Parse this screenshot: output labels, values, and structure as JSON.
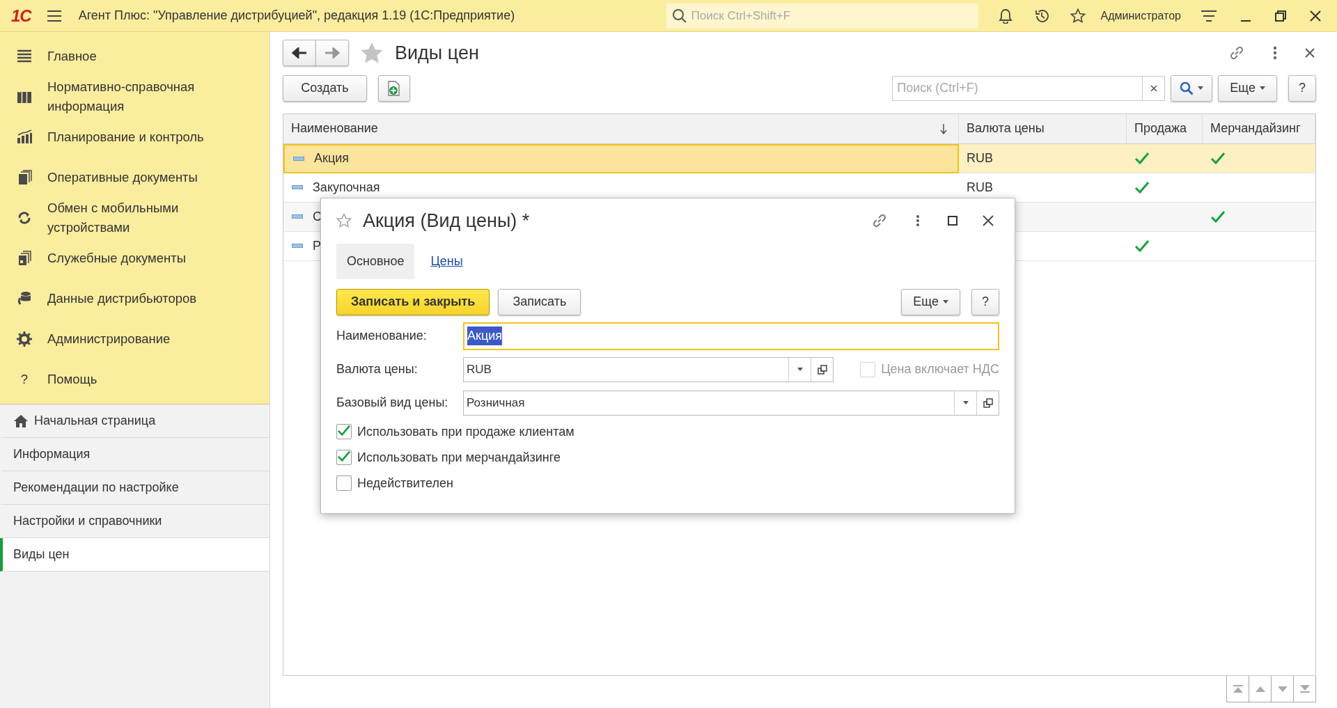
{
  "title_bar": {
    "logo": "1С",
    "title": "Агент Плюс: \"Управление дистрибуцией\", редакция 1.19  (1С:Предприятие)",
    "search_placeholder": "Поиск Ctrl+Shift+F",
    "user": "Администратор"
  },
  "sections": [
    {
      "label": "Главное"
    },
    {
      "label": "Нормативно-справочная информация"
    },
    {
      "label": "Планирование и контроль"
    },
    {
      "label": "Оперативные документы"
    },
    {
      "label": "Обмен с мобильными устройствами"
    },
    {
      "label": "Служебные документы"
    },
    {
      "label": "Данные дистрибьюторов"
    },
    {
      "label": "Администрирование"
    },
    {
      "label": "Помощь",
      "glyph": "?"
    }
  ],
  "open_pages": [
    {
      "label": "Начальная страница",
      "selected": false
    },
    {
      "label": "Информация",
      "selected": false
    },
    {
      "label": "Рекомендации по настройке",
      "selected": false
    },
    {
      "label": "Настройки и справочники",
      "selected": false
    },
    {
      "label": "Виды цен",
      "selected": true
    }
  ],
  "page": {
    "title": "Виды цен",
    "create_button": "Создать",
    "search_placeholder": "Поиск (Ctrl+F)",
    "more_button": "Еще",
    "help_button": "?"
  },
  "table": {
    "columns": [
      "Наименование",
      "Валюта цены",
      "Продажа",
      "Мерчандайзинг"
    ],
    "rows": [
      {
        "name": "Акция",
        "currency": "RUB",
        "sale": true,
        "merch": true,
        "selected": true
      },
      {
        "name": "Закупочная",
        "currency": "RUB",
        "sale": true,
        "merch": false,
        "selected": false
      },
      {
        "name": "С",
        "sale": false,
        "merch": true,
        "selected": false
      },
      {
        "name": "Р",
        "sale": true,
        "merch": false,
        "selected": false
      }
    ]
  },
  "dialog": {
    "title": "Акция (Вид цены) *",
    "tabs": [
      {
        "label": "Основное",
        "selected": true
      },
      {
        "label": "Цены",
        "selected": false
      }
    ],
    "save_close_button": "Записать и закрыть",
    "save_button": "Записать",
    "more_button": "Еще",
    "help_button": "?",
    "name_field": {
      "label": "Наименование:",
      "value": "Акция",
      "focused": true
    },
    "currency_field": {
      "label": "Валюта цены:",
      "value": "RUB"
    },
    "vat_checkbox": {
      "label": "Цена включает НДС",
      "checked": false,
      "disabled": true
    },
    "base_field": {
      "label": "Базовый вид цены:",
      "value": "Розничная"
    },
    "checkboxes": [
      {
        "label": "Использовать при продаже клиентам",
        "checked": true
      },
      {
        "label": "Использовать при мерчандайзинге",
        "checked": true
      },
      {
        "label": "Недействителен",
        "checked": false
      }
    ]
  }
}
